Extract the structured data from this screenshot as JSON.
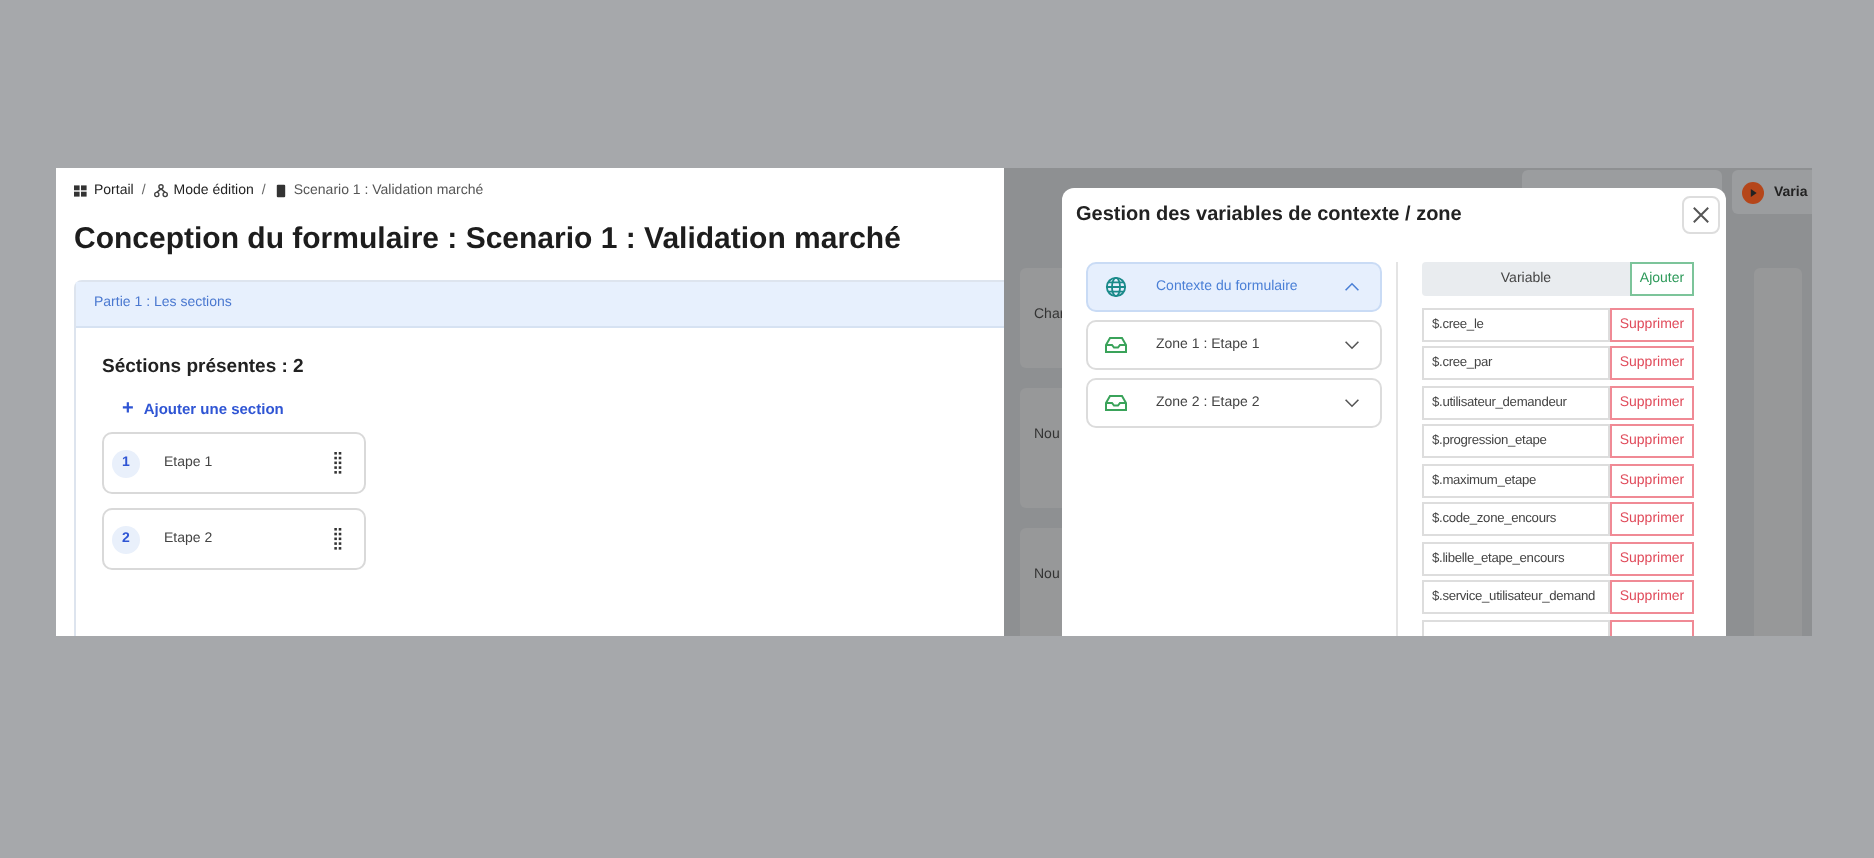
{
  "breadcrumb_separator": "/",
  "breadcrumb": [
    {
      "kind": "grid",
      "label": "Portail"
    },
    {
      "kind": "network",
      "label": "Mode édition"
    },
    {
      "kind": "document",
      "label": "Scenario 1 : Validation marché"
    }
  ],
  "title": "Conception du formulaire : Scenario 1 : Validation marché",
  "panel": {
    "header": "Partie 1 : Les sections",
    "count_label": "Séctions présentes : 2",
    "add_label": "Ajouter une section",
    "add_icon": "+",
    "sections": [
      {
        "number": "1",
        "label": "Etape 1"
      },
      {
        "number": "2",
        "label": "Etape 2"
      }
    ]
  },
  "background": {
    "toolbar_button": "Varia",
    "fields": [
      "Char",
      "Nou",
      "Nou"
    ]
  },
  "modal": {
    "title": "Gestion des variables de contexte / zone",
    "zones": [
      {
        "kind": "globe",
        "label": "Contexte du formulaire",
        "selected": true,
        "expanded": true
      },
      {
        "kind": "zone",
        "label": "Zone 1 : Etape 1",
        "selected": false,
        "expanded": false
      },
      {
        "kind": "zone",
        "label": "Zone 2 : Etape 2",
        "selected": false,
        "expanded": false
      }
    ],
    "table": {
      "header": "Variable",
      "add_label": "Ajouter",
      "rows": [
        {
          "variable": "$.cree_le",
          "action": "Supprimer"
        },
        {
          "variable": "$.cree_par",
          "action": "Supprimer"
        },
        {
          "variable": "$.utilisateur_demandeur",
          "action": "Supprimer"
        },
        {
          "variable": "$.progression_etape",
          "action": "Supprimer"
        },
        {
          "variable": "$.maximum_etape",
          "action": "Supprimer"
        },
        {
          "variable": "$.code_zone_encours",
          "action": "Supprimer"
        },
        {
          "variable": "$.libelle_etape_encours",
          "action": "Supprimer"
        },
        {
          "variable": "$.service_utilisateur_demand",
          "action": "Supprimer"
        }
      ]
    }
  }
}
